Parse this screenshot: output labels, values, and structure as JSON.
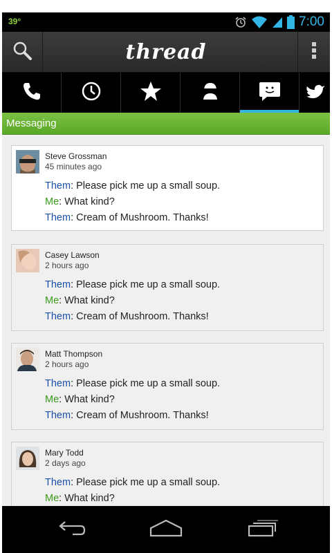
{
  "status_bar": {
    "temperature": "39°",
    "time": "7:00",
    "icons": [
      "alarm-icon",
      "wifi-icon",
      "signal-icon",
      "battery-icon"
    ]
  },
  "action_bar": {
    "title": "thread",
    "icons": [
      "search-icon",
      "overflow-menu-icon"
    ]
  },
  "tabs": [
    {
      "icon": "phone-icon"
    },
    {
      "icon": "clock-icon"
    },
    {
      "icon": "star-icon"
    },
    {
      "icon": "contact-icon"
    },
    {
      "icon": "message-icon",
      "selected": true
    },
    {
      "icon": "twitter-icon"
    }
  ],
  "section": {
    "title": "Messaging"
  },
  "conversations": [
    {
      "name": "Steve Grossman",
      "time": "45 minutes ago",
      "messages": [
        {
          "who": "Them",
          "sep": ": ",
          "text": "Please pick me up a small soup."
        },
        {
          "who": "Me",
          "sep": ": ",
          "text": "What kind?"
        },
        {
          "who": "Them",
          "sep": ": ",
          "text": "Cream of Mushroom.  Thanks!"
        }
      ]
    },
    {
      "name": "Casey Lawson",
      "time": "2 hours ago",
      "messages": [
        {
          "who": "Them",
          "sep": ": ",
          "text": "Please pick me up a small soup."
        },
        {
          "who": "Me",
          "sep": ": ",
          "text": "What kind?"
        },
        {
          "who": "Them",
          "sep": ": ",
          "text": "Cream of Mushroom.  Thanks!"
        }
      ]
    },
    {
      "name": "Matt Thompson",
      "time": "2 hours ago",
      "messages": [
        {
          "who": "Them",
          "sep": ": ",
          "text": "Please pick me up a small soup."
        },
        {
          "who": "Me",
          "sep": ": ",
          "text": "What kind?"
        },
        {
          "who": "Them",
          "sep": ": ",
          "text": "Cream of Mushroom.  Thanks!"
        }
      ]
    },
    {
      "name": "Mary Todd",
      "time": "2 days ago",
      "messages": [
        {
          "who": "Them",
          "sep": ": ",
          "text": "Please pick me up a small soup."
        },
        {
          "who": "Me",
          "sep": ": ",
          "text": "What kind?"
        }
      ]
    }
  ],
  "nav_bar": {
    "icons": [
      "back-icon",
      "home-icon",
      "recent-apps-icon"
    ]
  },
  "colors": {
    "accent": "#33b5e5",
    "section_green": "#6cb435",
    "them": "#1a4fa8",
    "me": "#3a9a1c"
  }
}
